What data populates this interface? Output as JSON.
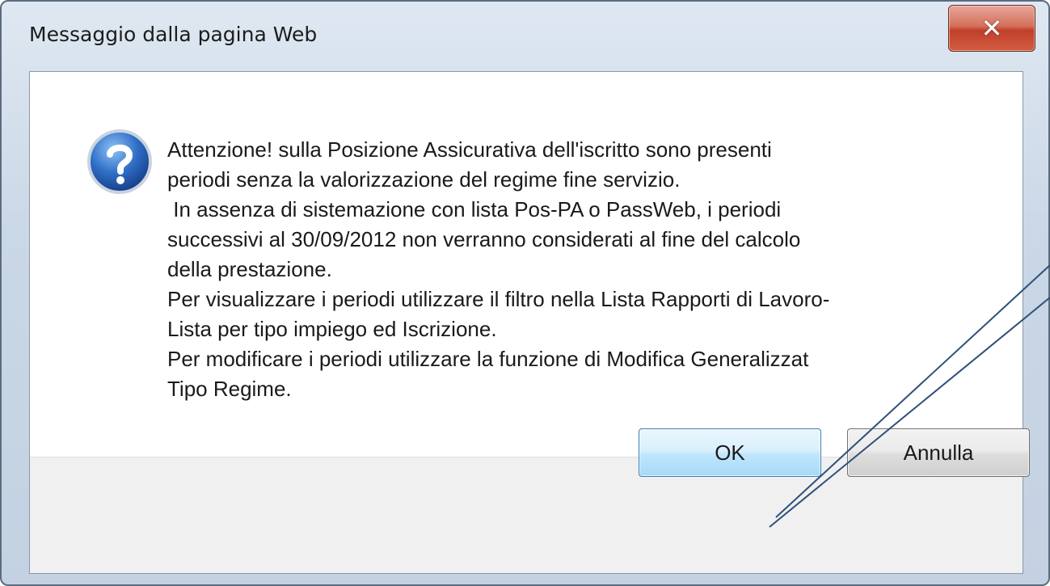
{
  "dialog": {
    "title": "Messaggio dalla pagina Web",
    "close_icon": "close-icon",
    "close_glyph": "✕",
    "message_icon": "question-icon",
    "message_lines": [
      "Attenzione! sulla Posizione Assicurativa dell'iscritto sono presenti",
      "periodi senza la valorizzazione del regime fine servizio.",
      " In assenza di sistemazione con lista Pos-PA o PassWeb, i periodi",
      "successivi al 30/09/2012 non verranno considerati al fine del calcolo",
      "della prestazione.",
      "Per visualizzare i periodi utilizzare il filtro nella Lista Rapporti di Lavoro-",
      "Lista per tipo impiego ed Iscrizione.",
      "Per modificare i periodi utilizzare la funzione di Modifica Generalizzat",
      "Tipo Regime."
    ],
    "buttons": {
      "ok_label": "OK",
      "cancel_label": "Annulla"
    }
  },
  "colors": {
    "title_bar": "#cad7e6",
    "close_button": "#c0402a",
    "ok_button_border": "#3c7fb1",
    "callout_line": "#2f4f7a"
  }
}
